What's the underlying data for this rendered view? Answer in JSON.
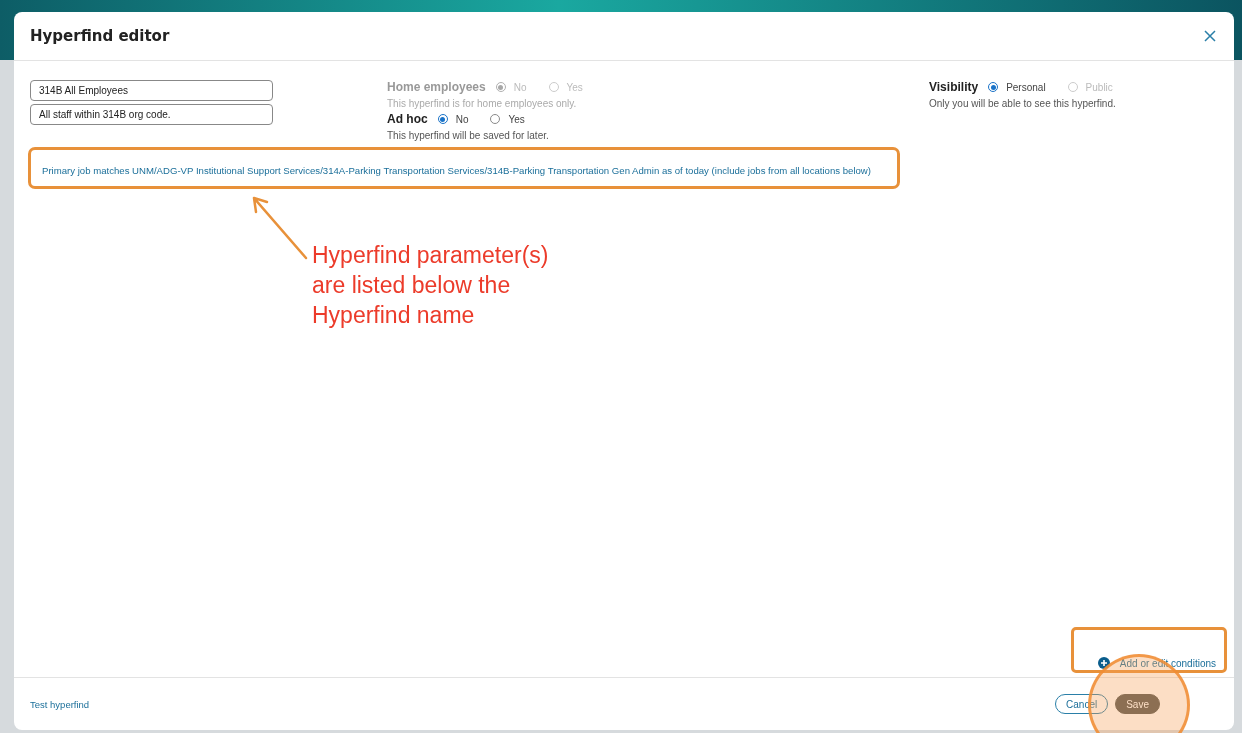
{
  "window": {
    "title": "Hyperfind editor"
  },
  "name_field": {
    "value": "314B All Employees"
  },
  "description_field": {
    "value": "All staff within 314B org code."
  },
  "options": [
    {
      "label": "Home employees",
      "disabled": true,
      "choices": [
        {
          "label": "No",
          "selected": true,
          "disabled": true
        },
        {
          "label": "Yes",
          "selected": false,
          "disabled": true
        }
      ],
      "hint": "This hyperfind is for home employees only."
    },
    {
      "label": "Ad hoc",
      "disabled": false,
      "choices": [
        {
          "label": "No",
          "selected": true,
          "disabled": false
        },
        {
          "label": "Yes",
          "selected": false,
          "disabled": false
        }
      ],
      "hint": "This hyperfind will be saved for later."
    },
    {
      "label": "Visibility",
      "disabled": false,
      "choices": [
        {
          "label": "Personal",
          "selected": true,
          "disabled": false
        },
        {
          "label": "Public",
          "selected": false,
          "disabled": true
        }
      ],
      "hint": "Only you will be able to see this hyperfind."
    }
  ],
  "parameters": [
    "Primary job matches UNM/ADG-VP Institutional Support Services/314A-Parking Transportation Services/314B-Parking Transportation Gen Admin as of today (include jobs from all locations below)"
  ],
  "add_conditions": {
    "label": "Add or edit conditions"
  },
  "footer": {
    "test_link": "Test hyperfind",
    "buttons": [
      {
        "label": "Cancel",
        "kind": "secondary"
      },
      {
        "label": "Save",
        "kind": "primary"
      }
    ]
  },
  "annotation": {
    "callout": "Hyperfind parameter(s) are listed below the Hyperfind name"
  }
}
